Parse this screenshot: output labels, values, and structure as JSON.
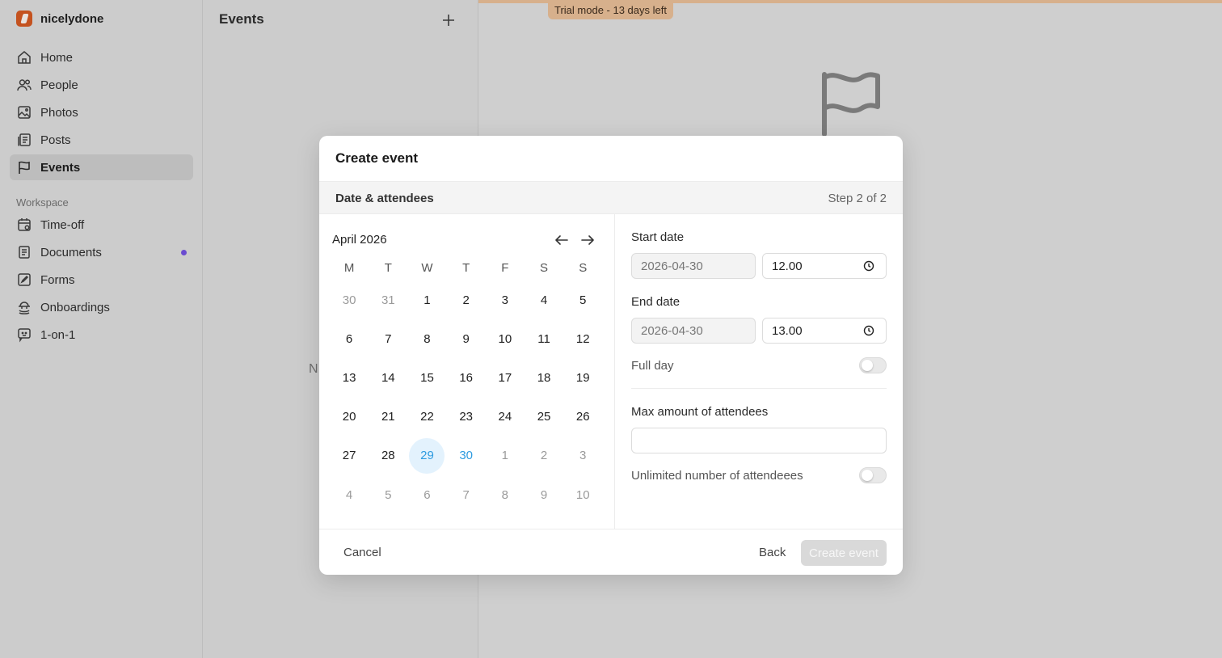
{
  "brand": {
    "name": "nicelydone"
  },
  "sidebar": {
    "items": [
      {
        "label": "Home",
        "icon": "home-icon"
      },
      {
        "label": "People",
        "icon": "people-icon"
      },
      {
        "label": "Photos",
        "icon": "photos-icon"
      },
      {
        "label": "Posts",
        "icon": "posts-icon"
      },
      {
        "label": "Events",
        "icon": "flag-icon",
        "active": true
      }
    ],
    "section_label": "Workspace",
    "workspace_items": [
      {
        "label": "Time-off",
        "icon": "calendar-icon"
      },
      {
        "label": "Documents",
        "icon": "document-icon",
        "unread_dot": true
      },
      {
        "label": "Forms",
        "icon": "form-icon"
      },
      {
        "label": "Onboardings",
        "icon": "onboarding-icon"
      },
      {
        "label": "1-on-1",
        "icon": "chat-icon"
      }
    ],
    "unread_dot_color": "#6a4bd0"
  },
  "events": {
    "title": "Events",
    "ghost_text": "N"
  },
  "trial": {
    "label": "Trial mode - 13 days left",
    "color": "#d7b08c"
  },
  "modal": {
    "title": "Create event",
    "step_title": "Date & attendees",
    "step_count": "Step 2 of 2",
    "calendar": {
      "month": "April 2026",
      "weekdays": [
        "M",
        "T",
        "W",
        "T",
        "F",
        "S",
        "S"
      ],
      "weeks": [
        [
          [
            "30",
            "muted"
          ],
          [
            "31",
            "muted"
          ],
          [
            "1",
            ""
          ],
          [
            "2",
            ""
          ],
          [
            "3",
            ""
          ],
          [
            "4",
            ""
          ],
          [
            "5",
            ""
          ]
        ],
        [
          [
            "6",
            ""
          ],
          [
            "7",
            ""
          ],
          [
            "8",
            ""
          ],
          [
            "9",
            ""
          ],
          [
            "10",
            ""
          ],
          [
            "11",
            ""
          ],
          [
            "12",
            ""
          ]
        ],
        [
          [
            "13",
            ""
          ],
          [
            "14",
            ""
          ],
          [
            "15",
            ""
          ],
          [
            "16",
            ""
          ],
          [
            "17",
            ""
          ],
          [
            "18",
            ""
          ],
          [
            "19",
            ""
          ]
        ],
        [
          [
            "20",
            ""
          ],
          [
            "21",
            ""
          ],
          [
            "22",
            ""
          ],
          [
            "23",
            ""
          ],
          [
            "24",
            ""
          ],
          [
            "25",
            ""
          ],
          [
            "26",
            ""
          ]
        ],
        [
          [
            "27",
            ""
          ],
          [
            "28",
            ""
          ],
          [
            "29",
            "today"
          ],
          [
            "30",
            "sel"
          ],
          [
            "1",
            "muted"
          ],
          [
            "2",
            "muted"
          ],
          [
            "3",
            "muted"
          ]
        ],
        [
          [
            "4",
            "muted"
          ],
          [
            "5",
            "muted"
          ],
          [
            "6",
            "muted"
          ],
          [
            "7",
            "muted"
          ],
          [
            "8",
            "muted"
          ],
          [
            "9",
            "muted"
          ],
          [
            "10",
            "muted"
          ]
        ]
      ],
      "accent_color": "#2e9be0"
    },
    "start_date": {
      "label": "Start date",
      "date": "2026-04-30",
      "time": "12.00"
    },
    "end_date": {
      "label": "End date",
      "date": "2026-04-30",
      "time": "13.00"
    },
    "full_day": {
      "label": "Full day",
      "on": false
    },
    "max_attendees": {
      "label": "Max amount of attendees",
      "value": ""
    },
    "unlimited": {
      "label": "Unlimited number of attendeees",
      "on": false
    },
    "buttons": {
      "cancel": "Cancel",
      "back": "Back",
      "create": "Create event"
    }
  }
}
